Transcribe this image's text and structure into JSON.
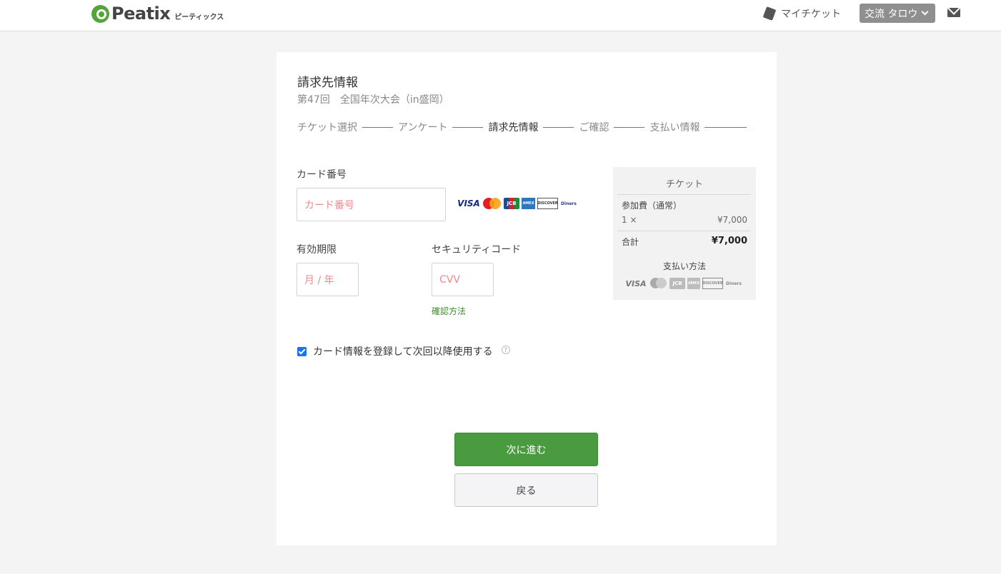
{
  "header": {
    "logo_text": "Peatix",
    "logo_sub": "ピーティックス",
    "my_tickets": "マイチケット",
    "user_name": "交流 タロウ"
  },
  "page": {
    "title": "請求先情報",
    "event": "第47回　全国年次大会（in盛岡）"
  },
  "steps": [
    "チケット選択",
    "アンケート",
    "請求先情報",
    "ご確認",
    "支払い情報"
  ],
  "form": {
    "card_label": "カード番号",
    "card_placeholder": "カード番号",
    "expiry_label": "有効期限",
    "expiry_placeholder": "月 / 年",
    "cvv_label": "セキュリティコード",
    "cvv_placeholder": "CVV",
    "cvv_help_link": "確認方法",
    "save_card_label": "カード情報を登録して次回以降使用する",
    "help_glyph": "?"
  },
  "card_brands": {
    "visa": "VISA",
    "jcb": "JCB",
    "amex": "AMEX",
    "discover": "DISCOVER",
    "diners": "Diners"
  },
  "summary": {
    "heading": "チケット",
    "item_name": "参加費（通常）",
    "qty": "1 ×",
    "item_price": "¥7,000",
    "total_label": "合計",
    "total_value": "¥7,000",
    "payment_heading": "支払い方法"
  },
  "buttons": {
    "next": "次に進む",
    "back": "戻る"
  }
}
